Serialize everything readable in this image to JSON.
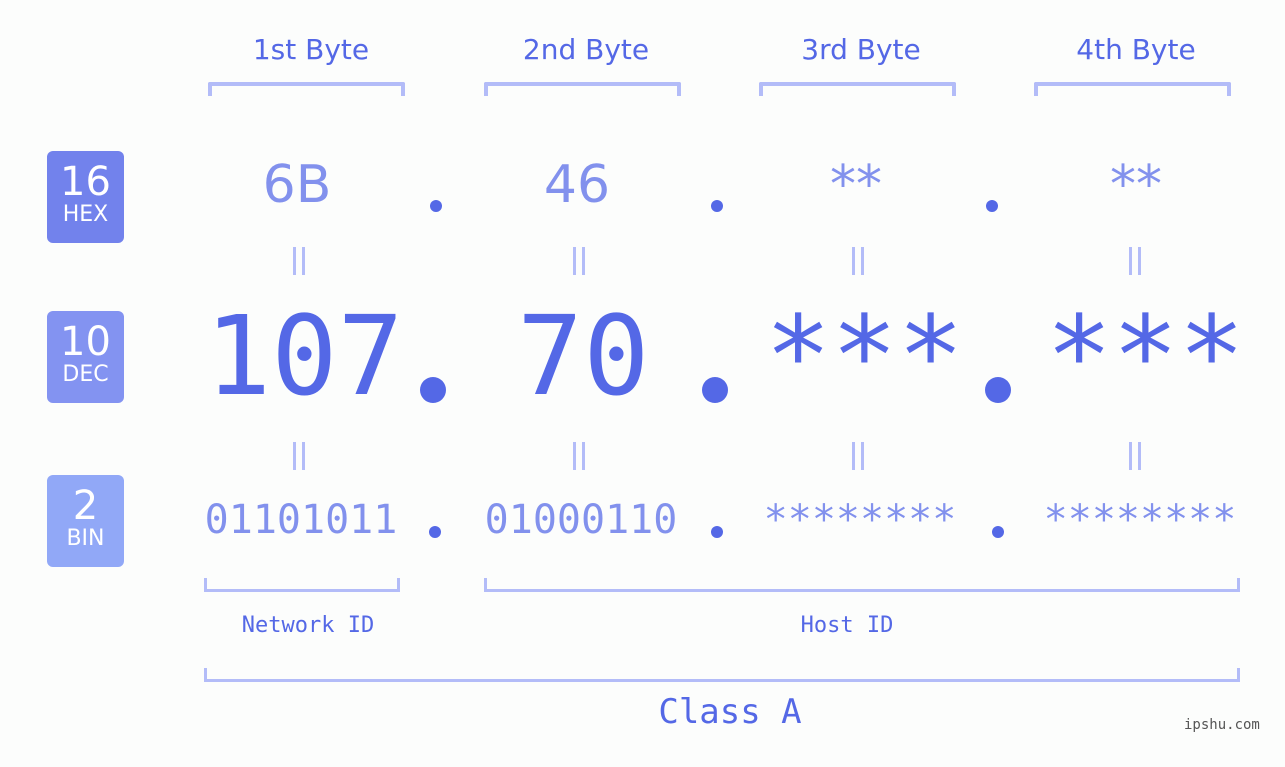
{
  "headers": [
    "1st Byte",
    "2nd Byte",
    "3rd Byte",
    "4th Byte"
  ],
  "badges": [
    {
      "num": "16",
      "label": "HEX",
      "color": "#7282ec"
    },
    {
      "num": "10",
      "label": "DEC",
      "color": "#8393f1"
    },
    {
      "num": "2",
      "label": "BIN",
      "color": "#91a8f7"
    }
  ],
  "hex": [
    "6B",
    "46",
    "**",
    "**"
  ],
  "dec": [
    "107",
    "70",
    "***",
    "***"
  ],
  "bin": [
    "01101011",
    "01000110",
    "********",
    "********"
  ],
  "network_label": "Network ID",
  "host_label": "Host ID",
  "class_label": "Class A",
  "watermark": "ipshu.com",
  "colors": {
    "accent": "#5468e6",
    "light": "#8291ed",
    "bracket": "#b3bcf8"
  }
}
